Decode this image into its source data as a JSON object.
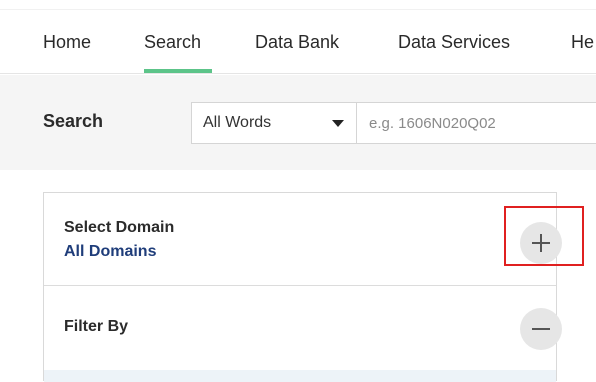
{
  "nav": {
    "items": [
      {
        "label": "Home"
      },
      {
        "label": "Search",
        "active": true
      },
      {
        "label": "Data Bank"
      },
      {
        "label": "Data Services"
      },
      {
        "label": "He"
      }
    ],
    "accent_color": "#5cc489"
  },
  "search": {
    "label": "Search",
    "mode_selected": "All Words",
    "placeholder": "e.g. 1606N020Q02"
  },
  "panel": {
    "domain": {
      "title": "Select Domain",
      "value": "All Domains",
      "action_icon": "plus-icon"
    },
    "filter": {
      "title": "Filter By",
      "action_icon": "minus-icon"
    }
  },
  "colors": {
    "link_blue": "#1f3d7a",
    "highlight_red": "#e02020"
  }
}
